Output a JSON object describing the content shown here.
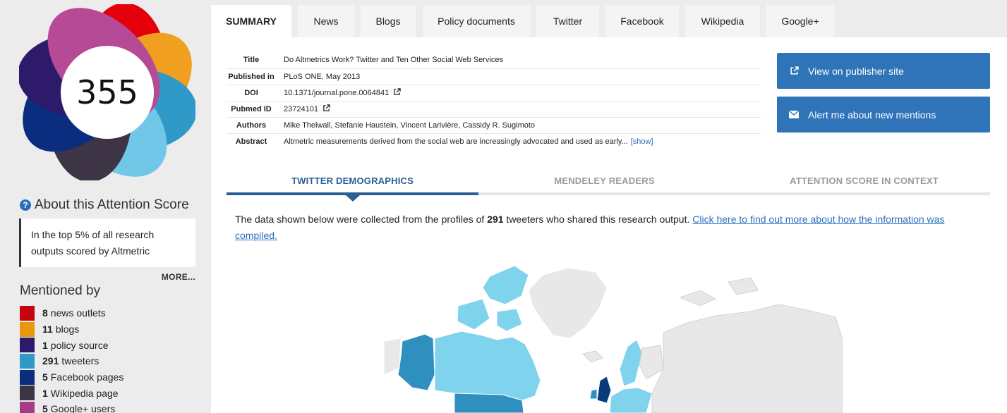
{
  "score": {
    "value": "355",
    "colors": [
      "#e4000b",
      "#f0a01e",
      "#2d1a6b",
      "#2f9ac7",
      "#0b2d80",
      "#3d3446",
      "#b64a97",
      "#71c7e8"
    ]
  },
  "about": {
    "title": "About this Attention Score",
    "icon": "question-circle-icon"
  },
  "context": {
    "text": "In the top 5% of all research outputs scored by Altmetric",
    "more": "MORE..."
  },
  "mentioned_by": {
    "title": "Mentioned by",
    "items": [
      {
        "count": "8",
        "label": "news outlets",
        "color": "#c4040e"
      },
      {
        "count": "11",
        "label": "blogs",
        "color": "#e8980f"
      },
      {
        "count": "1",
        "label": "policy source",
        "color": "#2d1a6b"
      },
      {
        "count": "291",
        "label": "tweeters",
        "color": "#2f9ac7"
      },
      {
        "count": "5",
        "label": "Facebook pages",
        "color": "#0b2d80"
      },
      {
        "count": "1",
        "label": "Wikipedia page",
        "color": "#3d3446"
      },
      {
        "count": "5",
        "label": "Google+ users",
        "color": "#a53c88"
      }
    ]
  },
  "tabs": [
    {
      "label": "SUMMARY",
      "active": true
    },
    {
      "label": "News"
    },
    {
      "label": "Blogs"
    },
    {
      "label": "Policy documents"
    },
    {
      "label": "Twitter"
    },
    {
      "label": "Facebook"
    },
    {
      "label": "Wikipedia"
    },
    {
      "label": "Google+"
    }
  ],
  "meta": {
    "title_label": "Title",
    "title": "Do Altmetrics Work? Twitter and Ten Other Social Web Services",
    "published_label": "Published in",
    "published": "PLoS ONE, May 2013",
    "doi_label": "DOI",
    "doi": "10.1371/journal.pone.0064841",
    "pubmed_label": "Pubmed ID",
    "pubmed": "23724101",
    "authors_label": "Authors",
    "authors": "Mike Thelwall, Stefanie Haustein, Vincent Larivière, Cassidy R. Sugimoto",
    "abstract_label": "Abstract",
    "abstract": "Altmetric measurements derived from the social web are increasingly advocated and used as early...",
    "show": "[show]"
  },
  "actions": {
    "publisher": "View on publisher site",
    "alert": "Alert me about new mentions"
  },
  "subtabs": [
    {
      "label": "TWITTER DEMOGRAPHICS",
      "active": true
    },
    {
      "label": "MENDELEY READERS"
    },
    {
      "label": "ATTENTION SCORE IN CONTEXT"
    }
  ],
  "intro": {
    "before": "The data shown below were collected from the profiles of ",
    "count": "291",
    "after": " tweeters who shared this research output. ",
    "link": "Click here to find out more about how the information was compiled."
  },
  "map": {
    "high_color": "#2f8fbf",
    "mid_color": "#7fd3ec",
    "low_color": "#e8e8e8"
  }
}
